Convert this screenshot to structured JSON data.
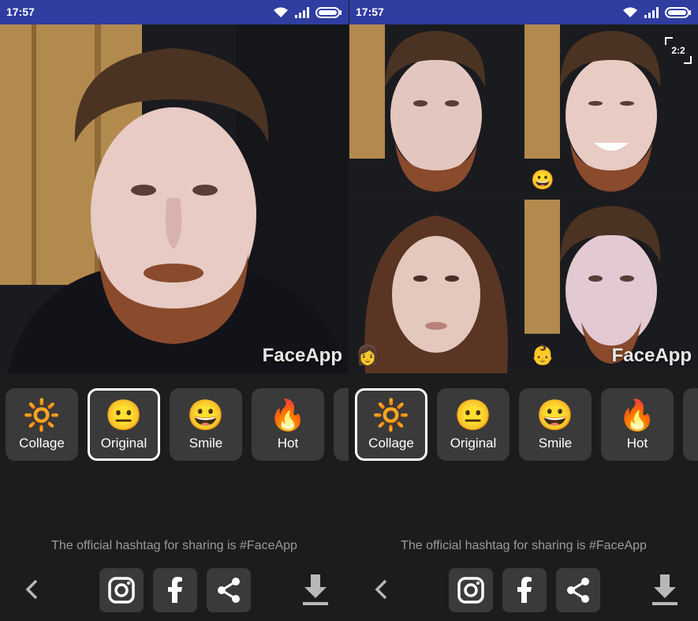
{
  "status_bar": {
    "time": "17:57"
  },
  "colors": {
    "status_bar": "#2f3da0",
    "background": "#1c1c1c",
    "tile": "#3a3a3a",
    "hashtag_text": "#9a9a9a"
  },
  "left_screen": {
    "watermark": "FaceApp",
    "selected_filter": "Original",
    "filters": [
      {
        "icon": "collage-icon",
        "glyph": "🔆",
        "label": "Collage"
      },
      {
        "icon": "neutral-face-icon",
        "glyph": "😐",
        "label": "Original"
      },
      {
        "icon": "smile-face-icon",
        "glyph": "😀",
        "label": "Smile"
      },
      {
        "icon": "fire-icon",
        "glyph": "🔥",
        "label": "Hot"
      }
    ]
  },
  "right_screen": {
    "watermark": "FaceApp",
    "ratio_badge": "2:2",
    "selected_filter": "Collage",
    "collage_badges": [
      {
        "icon": "smile-face-icon",
        "glyph": "😀"
      },
      {
        "icon": "woman-icon",
        "glyph": "👩"
      },
      {
        "icon": "baby-icon",
        "glyph": "👶"
      }
    ],
    "filters": [
      {
        "icon": "collage-icon",
        "glyph": "🔆",
        "label": "Collage"
      },
      {
        "icon": "neutral-face-icon",
        "glyph": "😐",
        "label": "Original"
      },
      {
        "icon": "smile-face-icon",
        "glyph": "😀",
        "label": "Smile"
      },
      {
        "icon": "fire-icon",
        "glyph": "🔥",
        "label": "Hot"
      }
    ]
  },
  "hashtag_text": "The official hashtag for sharing is #FaceApp",
  "bottom_bar": {
    "back_icon": "chevron-left-icon",
    "share_icons": [
      "instagram-icon",
      "facebook-icon",
      "share-icon"
    ],
    "download_icon": "download-icon"
  }
}
